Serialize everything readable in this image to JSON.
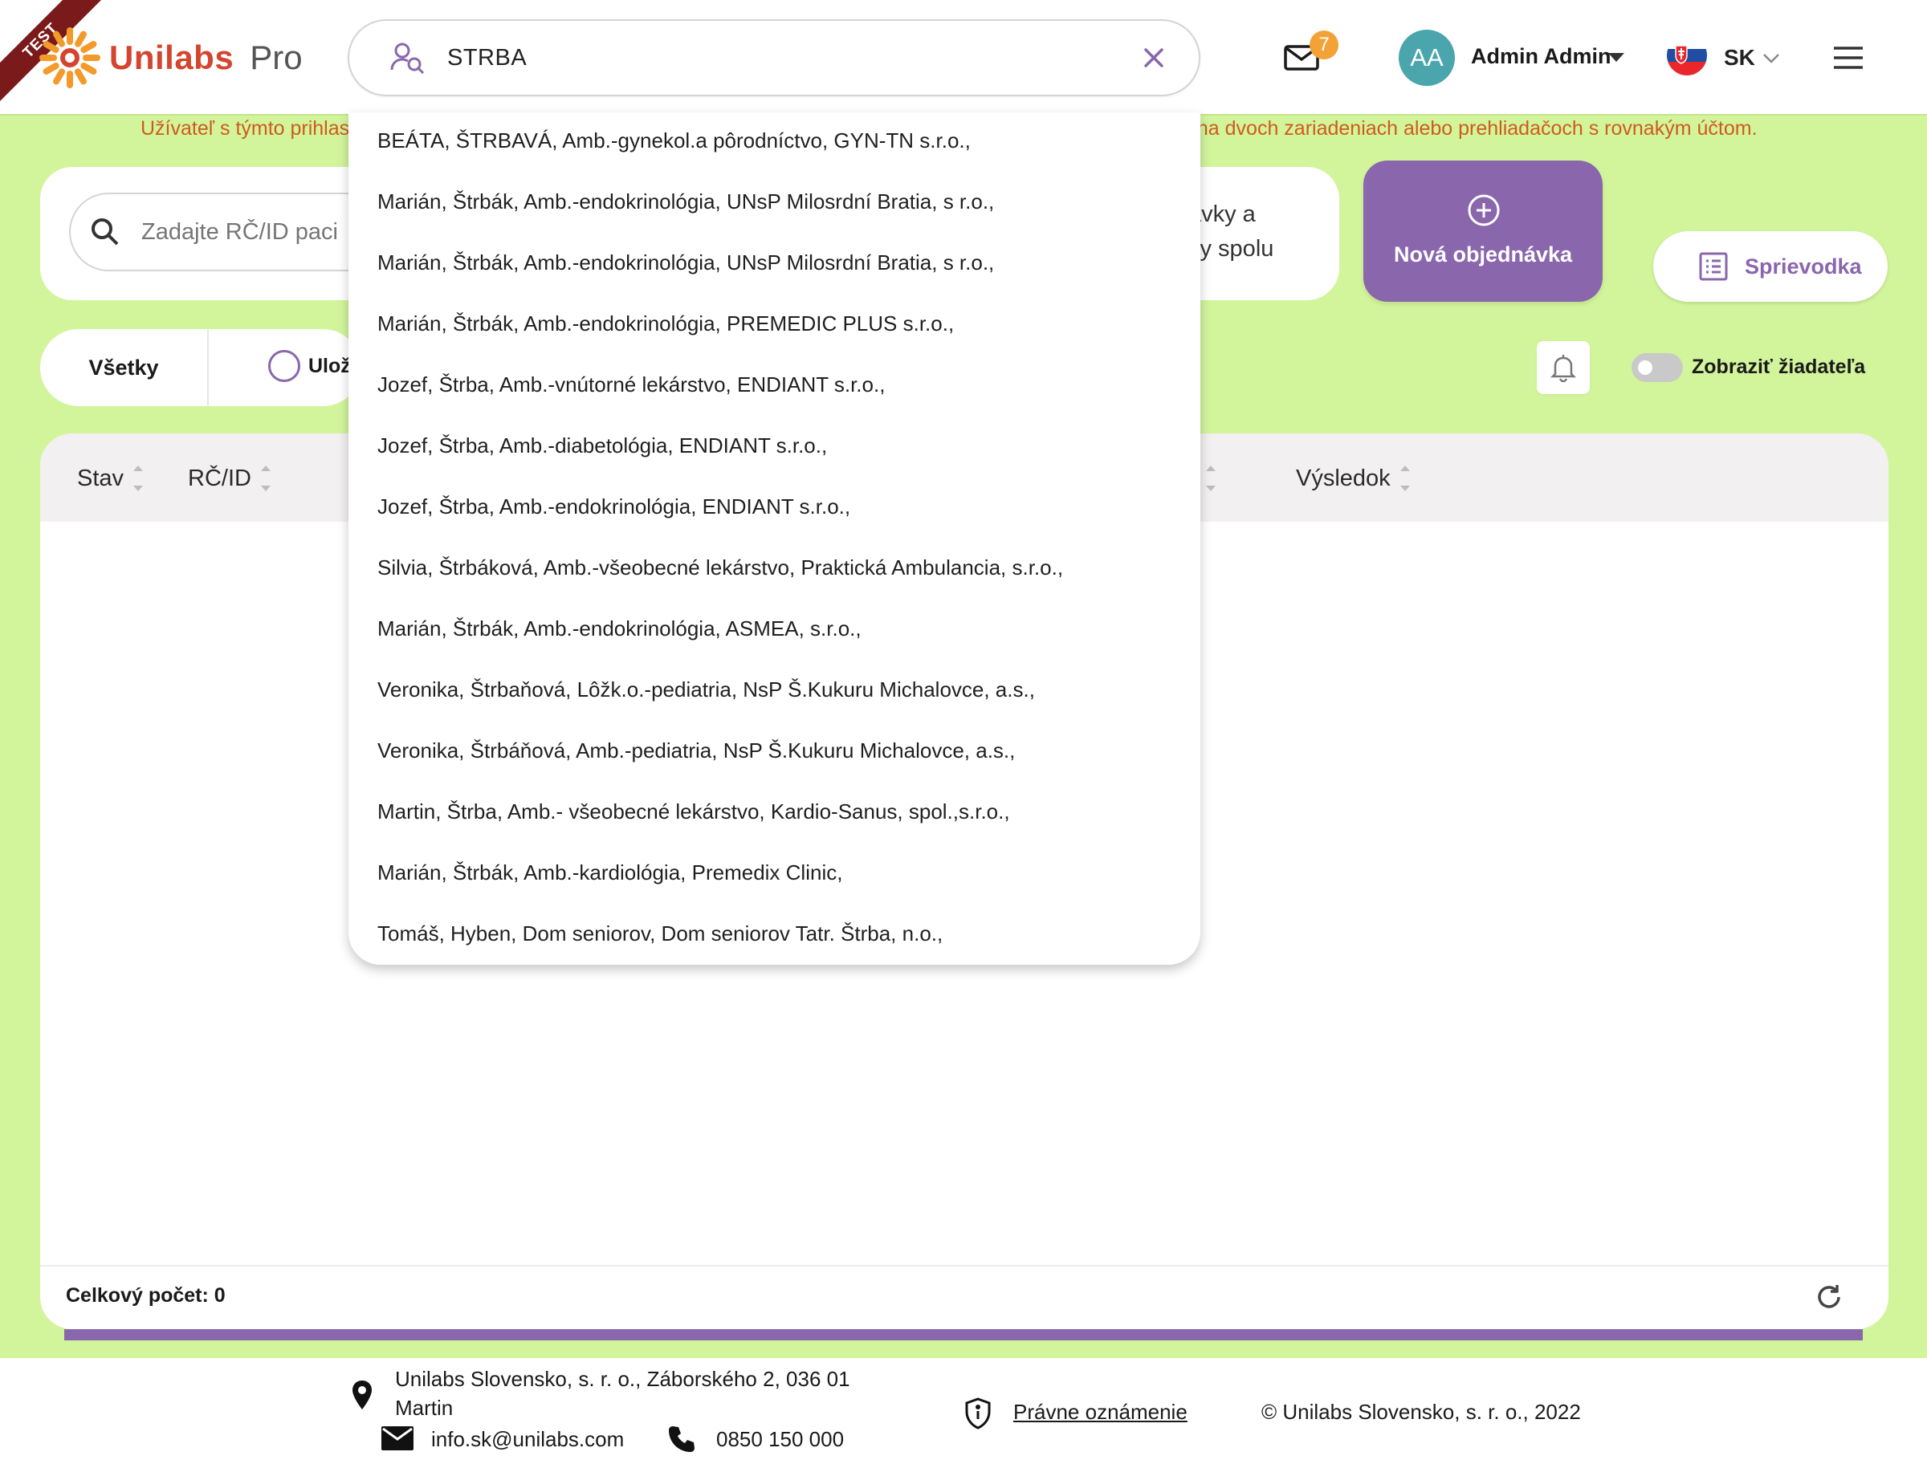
{
  "env_badge": "TEST",
  "brand": {
    "name": "Unilabs",
    "product": "Pro"
  },
  "search": {
    "value": "STRBA"
  },
  "mail": {
    "count": "7"
  },
  "user": {
    "initials": "AA",
    "name": "Admin Admin"
  },
  "language": {
    "code": "SK"
  },
  "warning": {
    "left": "Užívateľ s týmto prihlas",
    "right": "í na dvoch zariadeniach alebo prehliadačoch s rovnakým účtom."
  },
  "patient_search": {
    "placeholder": "Zadajte RČ/ID paci"
  },
  "combo_text": {
    "line1": "ávky a",
    "line2": "ky spolu"
  },
  "new_order": {
    "label": "Nová objednávka"
  },
  "guide": {
    "label": "Sprievodka"
  },
  "filters": {
    "all": "Všetky",
    "saved": "Ulože"
  },
  "toggle": {
    "label": "Zobraziť žiadateľa",
    "on": false
  },
  "table": {
    "columns": [
      "Stav",
      "RČ/ID",
      "Výsledok"
    ],
    "total": "Celkový počet: 0"
  },
  "suggestions": [
    "BEÁTA, ŠTRBAVÁ, Amb.-gynekol.a pôrodníctvo, GYN-TN s.r.o.,",
    "Marián, Štrbák, Amb.-endokrinológia, UNsP Milosrdní Bratia, s r.o.,",
    "Marián, Štrbák, Amb.-endokrinológia, UNsP Milosrdní Bratia, s r.o.,",
    "Marián, Štrbák, Amb.-endokrinológia, PREMEDIC PLUS s.r.o.,",
    "Jozef, Štrba, Amb.-vnútorné lekárstvo, ENDIANT s.r.o.,",
    "Jozef, Štrba, Amb.-diabetológia, ENDIANT s.r.o.,",
    "Jozef, Štrba, Amb.-endokrinológia, ENDIANT s.r.o.,",
    "Silvia, Štrbáková, Amb.-všeobecné lekárstvo, Praktická Ambulancia, s.r.o.,",
    "Marián, Štrbák, Amb.-endokrinológia, ASMEA, s.r.o.,",
    "Veronika, Štrbaňová, Lôžk.o.-pediatria, NsP Š.Kukuru Michalovce, a.s.,",
    "Veronika, Štrbáňová, Amb.-pediatria, NsP Š.Kukuru Michalovce, a.s.,",
    "Martin, Štrba, Amb.- všeobecné lekárstvo, Kardio-Sanus, spol.,s.r.o.,",
    "Marián, Štrbák, Amb.-kardiológia, Premedix Clinic,",
    "Tomáš, Hyben, Dom seniorov, Dom seniorov Tatr. Štrba, n.o.,"
  ],
  "footer": {
    "address_line1": "Unilabs Slovensko, s. r. o., Záborského 2, 036 01",
    "address_line2": "Martin",
    "email": "info.sk@unilabs.com",
    "phone": "0850 150 000",
    "legal": "Právne oznámenie",
    "copyright": "© Unilabs Slovensko, s. r. o., 2022"
  },
  "colors": {
    "page_bg": "#d2f59c",
    "accent_purple": "#8a66ad",
    "brand_red": "#d4452f",
    "warning": "#d15a1c",
    "avatar": "#4ba5ac",
    "badge": "#f2a236"
  },
  "icons": [
    "user-search-icon",
    "clear-icon",
    "mail-icon",
    "chevron-down-icon",
    "menu-icon",
    "search-icon",
    "plus-circle-icon",
    "document-list-icon",
    "radio-icon",
    "bell-icon",
    "refresh-icon",
    "location-pin-icon",
    "email-icon",
    "phone-icon",
    "shield-info-icon",
    "flag-sk-icon"
  ]
}
